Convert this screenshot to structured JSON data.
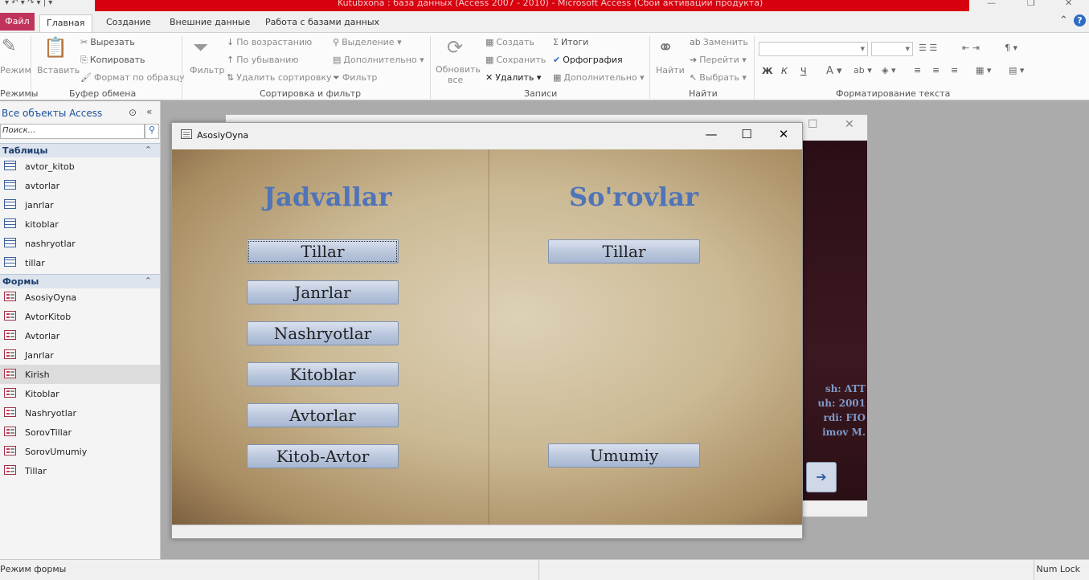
{
  "app": {
    "title": "Kutubxona : база данных (Access 2007 - 2010)  -  Microsoft Access (Сбой активации продукта)",
    "qat": "▾ ↶ ▾ ↷ ▾ | ▾"
  },
  "ribbon_tabs": [
    "Файл",
    "Главная",
    "Создание",
    "Внешние данные",
    "Работа с базами данных"
  ],
  "ribbon": {
    "modes": {
      "label": "Режим",
      "group": "Режимы"
    },
    "clipboard": {
      "paste": "Вставить",
      "cut": "Вырезать",
      "copy": "Копировать",
      "format": "Формат по образцу",
      "group": "Буфер обмена"
    },
    "sort": {
      "filter": "Фильтр",
      "asc": "По возрастанию",
      "desc": "По убыванию",
      "remove": "Удалить сортировку",
      "selection": "Выделение",
      "advanced": "Дополнительно",
      "toggle": "Фильтр",
      "group": "Сортировка и фильтр"
    },
    "records": {
      "refresh": "Обновить",
      "refresh2": "все",
      "new": "Создать",
      "save": "Сохранить",
      "delete": "Удалить",
      "totals": "Итоги",
      "spelling": "Орфография",
      "more": "Дополнительно",
      "group": "Записи"
    },
    "find": {
      "find": "Найти",
      "replace": "Заменить",
      "goto": "Перейти",
      "select": "Выбрать",
      "group": "Найти"
    },
    "text": {
      "group": "Форматирование текста"
    }
  },
  "nav": {
    "header": "Все объекты Access",
    "search_placeholder": "Поиск...",
    "sections": [
      {
        "title": "Таблицы",
        "items": [
          "avtor_kitob",
          "avtorlar",
          "janrlar",
          "kitoblar",
          "nashryotlar",
          "tillar"
        ]
      },
      {
        "title": "Формы",
        "items": [
          "AsosiyOyna",
          "AvtorKitob",
          "Avtorlar",
          "Janrlar",
          "Kirish",
          "Kitoblar",
          "Nashryotlar",
          "SorovTillar",
          "SorovUmumiy",
          "Tillar"
        ]
      }
    ],
    "selected_item": "Kirish"
  },
  "background_window": {
    "info_lines": [
      "sh: ATT",
      "uh: 2001",
      "rdi: FIO",
      "imov M."
    ],
    "arrow": "➔"
  },
  "form": {
    "title": "AsosiyOyna",
    "left_heading": "Jadvallar",
    "right_heading": "So'rovlar",
    "left_buttons": [
      "Tillar",
      "Janrlar",
      "Nashryotlar",
      "Kitoblar",
      "Avtorlar",
      "Kitob-Avtor"
    ],
    "right_buttons": [
      "Tillar",
      "Umumiy"
    ]
  },
  "status": {
    "left": "Режим формы",
    "right": "Num Lock"
  }
}
